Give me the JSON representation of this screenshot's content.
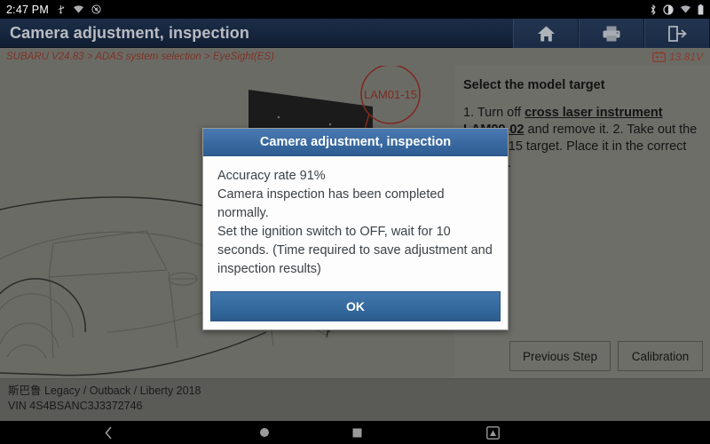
{
  "statusbar": {
    "clock": "2:47 PM",
    "left_icons": [
      "usb-icon",
      "wifi-icon",
      "no-sound-icon"
    ],
    "right_icons": [
      "bluetooth-icon",
      "brightness-icon",
      "wifi-icon",
      "battery-icon"
    ]
  },
  "titlebar": {
    "title": "Camera adjustment, inspection",
    "buttons": [
      {
        "name": "home-button",
        "icon": "home-icon"
      },
      {
        "name": "print-button",
        "icon": "printer-icon"
      },
      {
        "name": "exit-button",
        "icon": "exit-icon"
      }
    ]
  },
  "breadcrumb": {
    "path": "SUBARU V24.83 > ADAS system selection > EyeSight(ES)",
    "voltage": "13.81V",
    "battery_icon": "battery-icon"
  },
  "illustration": {
    "callout_label": "LAM01-15",
    "callout_color": "#7d2b20",
    "alt": "subaru-target-board-and-vehicle-diagram"
  },
  "right_panel": {
    "heading": "Select the model target",
    "step1_prefix": "1. Turn off ",
    "step1_link": "cross laser instrument LAM09-02",
    "step1_suffix": " and remove it.",
    "step2": "2. Take out the LAM01-15 target. Place it in the correct position.",
    "buttons": {
      "previous": "Previous Step",
      "calibration": "Calibration"
    }
  },
  "vehicle_info": {
    "model": "斯巴鲁 Legacy / Outback / Liberty 2018",
    "vin": "VIN 4S4BSANC3J3372746"
  },
  "dialog": {
    "title": "Camera adjustment, inspection",
    "lines": [
      "Accuracy rate 91%",
      "Camera inspection has been completed normally.",
      "Set the ignition switch to OFF, wait for 10 seconds. (Time required to save adjustment and inspection results)"
    ],
    "ok_label": "OK",
    "accent_color": "#3a6aa2"
  },
  "navbar": {
    "items": [
      {
        "name": "nav-back-button",
        "icon": "chevron-left-icon"
      },
      {
        "name": "nav-home-button",
        "icon": "circle-icon"
      },
      {
        "name": "nav-recents-button",
        "icon": "square-icon"
      },
      {
        "name": "nav-screenshot-button",
        "icon": "screenshot-icon"
      }
    ]
  }
}
